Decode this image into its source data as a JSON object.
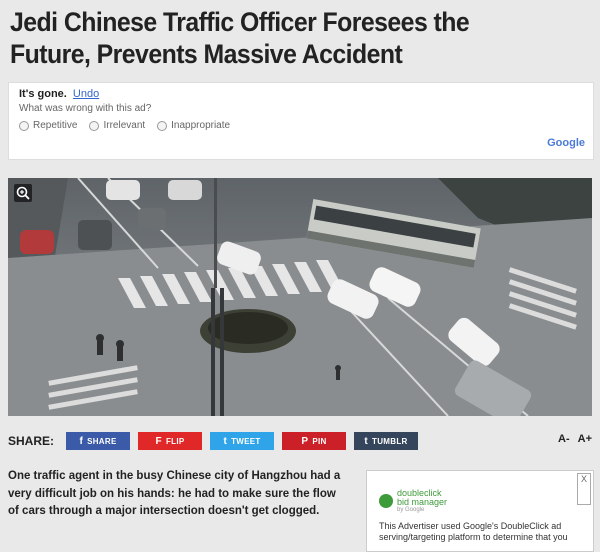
{
  "article": {
    "headline": "Jedi Chinese Traffic Officer Foresees the Future, Prevents Massive Accident",
    "body": "One traffic agent in the busy Chinese city of Hangzhou had a very difficult job on his hands: he had to make sure the flow of cars through a major intersection doesn't get clogged."
  },
  "ad_feedback": {
    "gone_text": "It's gone.",
    "undo_label": "Undo",
    "question": "What was wrong with this ad?",
    "options": [
      "Repetitive",
      "Irrelevant",
      "Inappropriate"
    ],
    "brand": "Google"
  },
  "share": {
    "label": "SHARE:",
    "buttons": [
      {
        "label": "SHARE",
        "icon": "f",
        "color": "#3b5ba8"
      },
      {
        "label": "FLIP",
        "icon": "F",
        "color": "#e12828"
      },
      {
        "label": "TWEET",
        "icon": "t",
        "color": "#2fa4e8"
      },
      {
        "label": "PIN",
        "icon": "P",
        "color": "#cb2027"
      },
      {
        "label": "TUMBLR",
        "icon": "t",
        "color": "#35465c"
      }
    ],
    "font_smaller": "A-",
    "font_larger": "A+"
  },
  "side_ad": {
    "close": "X",
    "logo_line1": "doubleclick",
    "logo_line2": "bid manager",
    "logo_sub": "by Google",
    "text": "This Advertiser used Google's DoubleClick ad serving/targeting platform to determine that you"
  },
  "icons": {
    "zoom": "zoom-in-icon"
  }
}
